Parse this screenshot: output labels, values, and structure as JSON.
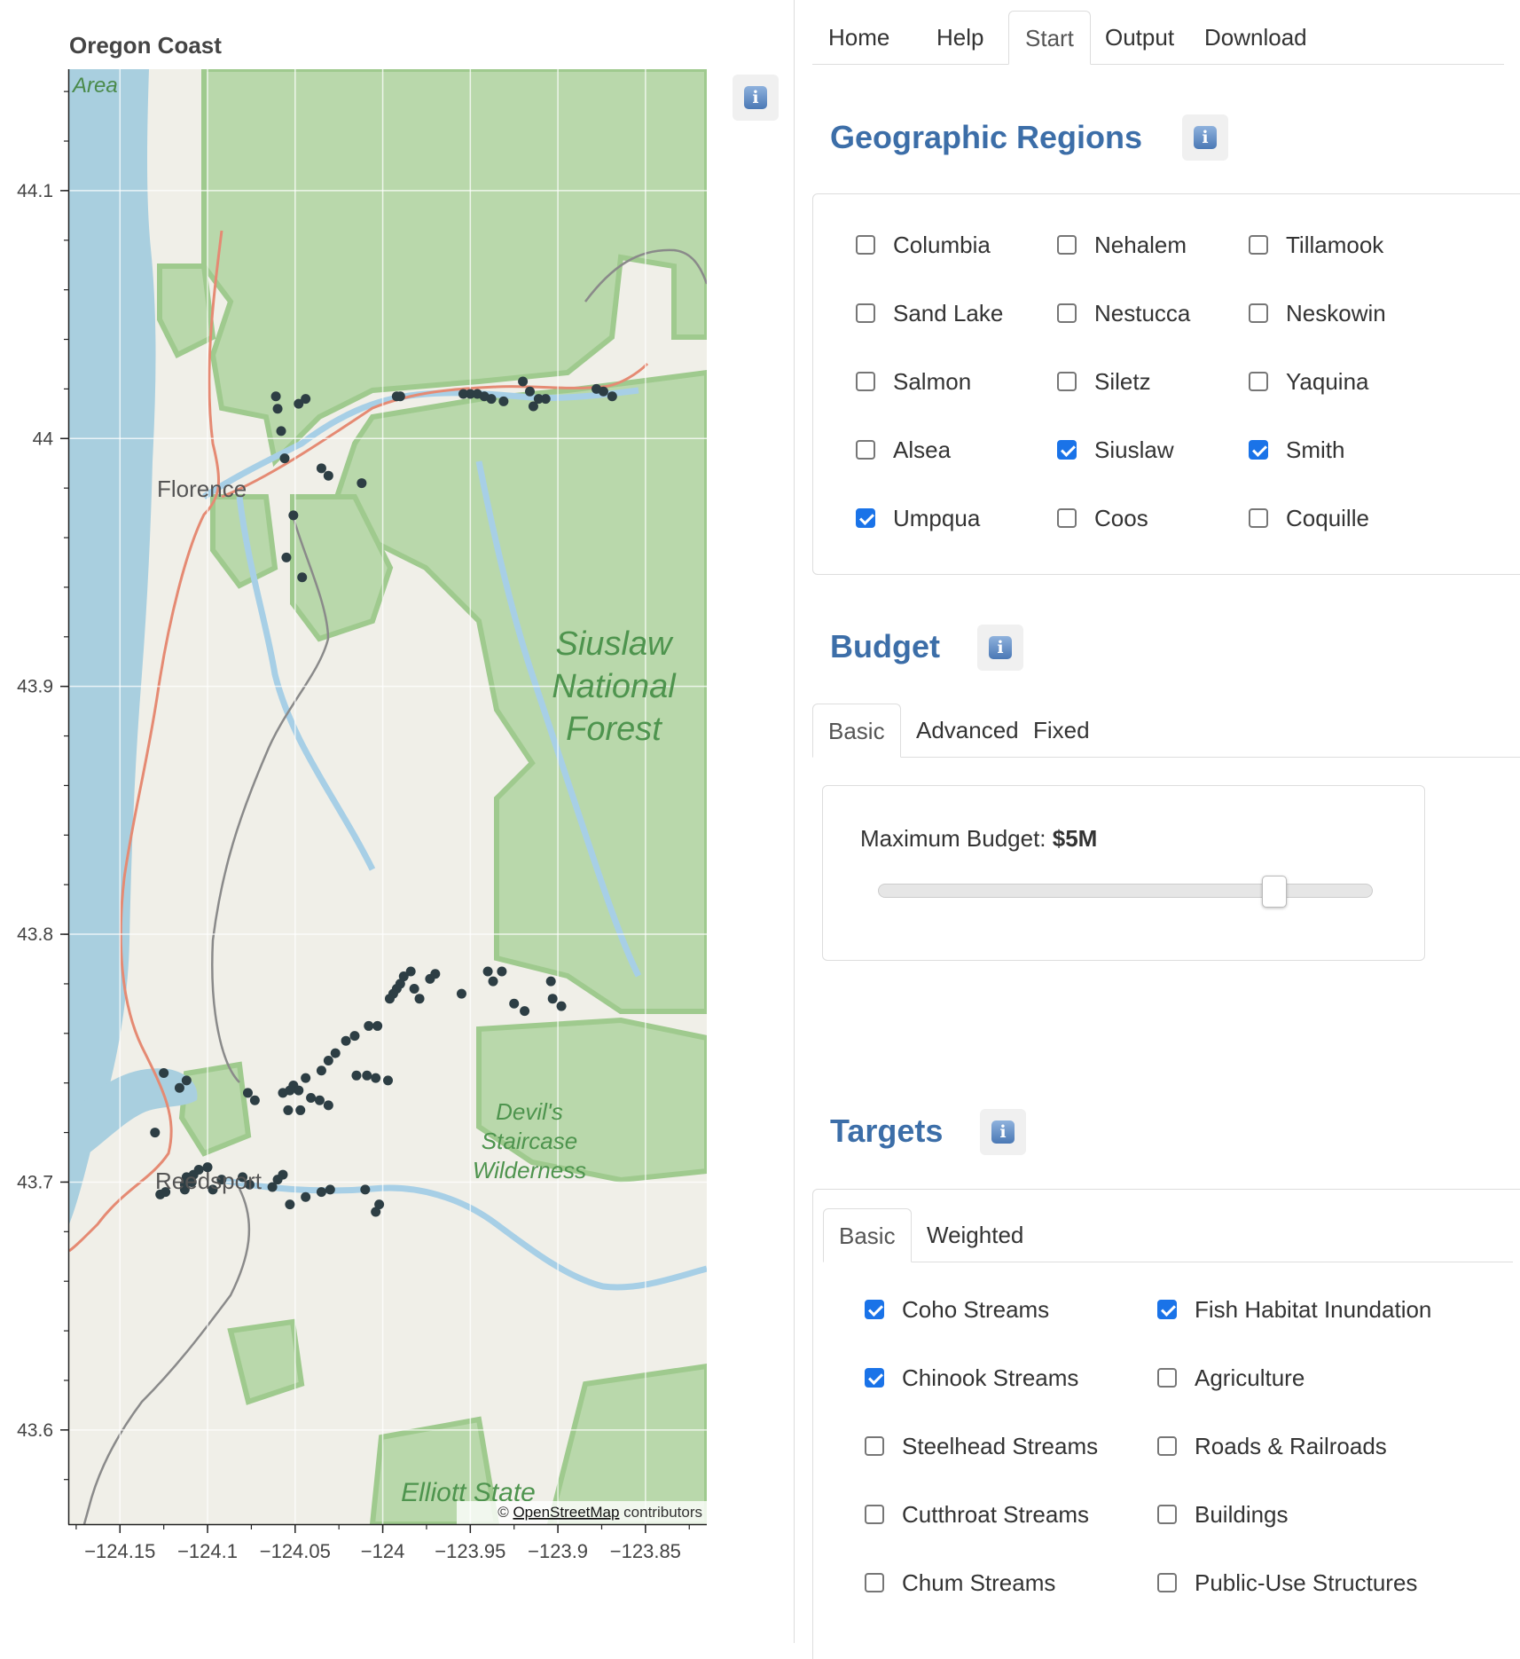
{
  "map": {
    "title": "Oregon Coast",
    "attribution": {
      "prefix": "© ",
      "link": "OpenStreetMap",
      "suffix": " contributors"
    },
    "labels": {
      "florence": "Florence",
      "reedsport": "Reedsport",
      "area": "Area",
      "forest1": "Siuslaw",
      "forest2": "National",
      "forest3": "Forest",
      "wild1": "Devil's",
      "wild2": "Staircase",
      "wild3": "Wilderness",
      "elliott": "Elliott State"
    },
    "colors": {
      "ocean": "#a9cfdf",
      "land": "#f0efe8",
      "forest": "#b9d8ab",
      "forest_edge": "#9fca8e",
      "river": "#a7cfe6",
      "highway": "#e58a73",
      "road": "#8a8a8a",
      "point": "#2d3e44"
    }
  },
  "chart_data": {
    "type": "scatter",
    "title": "Oregon Coast",
    "xlabel": "",
    "ylabel": "",
    "xlim": [
      -124.179,
      -123.815
    ],
    "ylim": [
      43.562,
      44.149
    ],
    "grid": true,
    "xticks": [
      -124.15,
      -124.1,
      -124.05,
      -124,
      -123.95,
      -123.9,
      -123.85
    ],
    "xtick_labels": [
      "−124.15",
      "−124.1",
      "−124.05",
      "−124",
      "−123.95",
      "−123.9",
      "−123.85"
    ],
    "yticks": [
      43.6,
      43.7,
      43.8,
      43.9,
      44,
      44.1
    ],
    "ytick_labels": [
      "43.6",
      "43.7",
      "43.8",
      "43.9",
      "44",
      "44.1"
    ],
    "points": [
      [
        -124.06,
        44.012
      ],
      [
        -124.061,
        44.017
      ],
      [
        -124.058,
        44.003
      ],
      [
        -124.056,
        43.992
      ],
      [
        -124.048,
        44.014
      ],
      [
        -124.044,
        44.016
      ],
      [
        -124.035,
        43.988
      ],
      [
        -124.031,
        43.985
      ],
      [
        -124.012,
        43.982
      ],
      [
        -124.051,
        43.969
      ],
      [
        -124.055,
        43.952
      ],
      [
        -124.046,
        43.944
      ],
      [
        -123.992,
        44.017
      ],
      [
        -123.99,
        44.017
      ],
      [
        -123.954,
        44.018
      ],
      [
        -123.95,
        44.018
      ],
      [
        -123.946,
        44.018
      ],
      [
        -123.942,
        44.017
      ],
      [
        -123.938,
        44.016
      ],
      [
        -123.931,
        44.015
      ],
      [
        -123.92,
        44.023
      ],
      [
        -123.916,
        44.019
      ],
      [
        -123.914,
        44.013
      ],
      [
        -123.911,
        44.016
      ],
      [
        -123.907,
        44.016
      ],
      [
        -123.878,
        44.02
      ],
      [
        -123.874,
        44.019
      ],
      [
        -123.869,
        44.017
      ],
      [
        -123.984,
        43.785
      ],
      [
        -123.988,
        43.783
      ],
      [
        -123.99,
        43.78
      ],
      [
        -123.992,
        43.778
      ],
      [
        -123.994,
        43.776
      ],
      [
        -123.996,
        43.774
      ],
      [
        -123.982,
        43.778
      ],
      [
        -123.979,
        43.774
      ],
      [
        -123.973,
        43.782
      ],
      [
        -123.97,
        43.784
      ],
      [
        -123.955,
        43.776
      ],
      [
        -123.94,
        43.785
      ],
      [
        -123.937,
        43.781
      ],
      [
        -123.932,
        43.785
      ],
      [
        -123.925,
        43.772
      ],
      [
        -123.919,
        43.769
      ],
      [
        -123.904,
        43.781
      ],
      [
        -123.903,
        43.774
      ],
      [
        -123.898,
        43.771
      ],
      [
        -124.003,
        43.763
      ],
      [
        -124.008,
        43.763
      ],
      [
        -124.016,
        43.759
      ],
      [
        -124.021,
        43.757
      ],
      [
        -124.027,
        43.752
      ],
      [
        -124.031,
        43.749
      ],
      [
        -124.035,
        43.745
      ],
      [
        -124.015,
        43.743
      ],
      [
        -124.009,
        43.743
      ],
      [
        -124.004,
        43.742
      ],
      [
        -123.997,
        43.741
      ],
      [
        -124.051,
        43.739
      ],
      [
        -124.048,
        43.737
      ],
      [
        -124.044,
        43.742
      ],
      [
        -124.041,
        43.734
      ],
      [
        -124.036,
        43.733
      ],
      [
        -124.031,
        43.731
      ],
      [
        -124.053,
        43.737
      ],
      [
        -124.057,
        43.736
      ],
      [
        -124.073,
        43.733
      ],
      [
        -124.077,
        43.736
      ],
      [
        -124.054,
        43.729
      ],
      [
        -124.047,
        43.729
      ],
      [
        -124.125,
        43.744
      ],
      [
        -124.116,
        43.738
      ],
      [
        -124.112,
        43.741
      ],
      [
        -124.13,
        43.72
      ],
      [
        -124.112,
        43.702
      ],
      [
        -124.108,
        43.703
      ],
      [
        -124.105,
        43.705
      ],
      [
        -124.1,
        43.706
      ],
      [
        -124.113,
        43.699
      ],
      [
        -124.109,
        43.7
      ],
      [
        -124.092,
        43.701
      ],
      [
        -124.08,
        43.702
      ],
      [
        -124.076,
        43.699
      ],
      [
        -124.127,
        43.695
      ],
      [
        -124.124,
        43.696
      ],
      [
        -124.113,
        43.697
      ],
      [
        -124.097,
        43.697
      ],
      [
        -124.06,
        43.701
      ],
      [
        -124.057,
        43.703
      ],
      [
        -124.063,
        43.698
      ],
      [
        -124.053,
        43.691
      ],
      [
        -124.044,
        43.694
      ],
      [
        -124.035,
        43.696
      ],
      [
        -124.03,
        43.697
      ],
      [
        -124.01,
        43.697
      ],
      [
        -124.002,
        43.691
      ],
      [
        -124.004,
        43.688
      ]
    ]
  },
  "map_ui": {
    "info_icon": "info-icon"
  },
  "nav": {
    "items": [
      "Home",
      "Help",
      "Start",
      "Output",
      "Download"
    ],
    "active": "Start"
  },
  "regions": {
    "title": "Geographic Regions",
    "items": [
      {
        "label": "Columbia",
        "checked": false
      },
      {
        "label": "Nehalem",
        "checked": false
      },
      {
        "label": "Tillamook",
        "checked": false
      },
      {
        "label": "Sand Lake",
        "checked": false
      },
      {
        "label": "Nestucca",
        "checked": false
      },
      {
        "label": "Neskowin",
        "checked": false
      },
      {
        "label": "Salmon",
        "checked": false
      },
      {
        "label": "Siletz",
        "checked": false
      },
      {
        "label": "Yaquina",
        "checked": false
      },
      {
        "label": "Alsea",
        "checked": false
      },
      {
        "label": "Siuslaw",
        "checked": true
      },
      {
        "label": "Smith",
        "checked": true
      },
      {
        "label": "Umpqua",
        "checked": true
      },
      {
        "label": "Coos",
        "checked": false
      },
      {
        "label": "Coquille",
        "checked": false
      }
    ]
  },
  "budget": {
    "title": "Budget",
    "tabs": [
      "Basic",
      "Advanced",
      "Fixed"
    ],
    "active_tab": "Basic",
    "label": "Maximum Budget: ",
    "value": "$5M",
    "slider_fraction": 0.8
  },
  "targets": {
    "title": "Targets",
    "tabs": [
      "Basic",
      "Weighted"
    ],
    "active_tab": "Basic",
    "items": [
      {
        "label": "Coho Streams",
        "checked": true
      },
      {
        "label": "Fish Habitat Inundation",
        "checked": true
      },
      {
        "label": "Chinook Streams",
        "checked": true
      },
      {
        "label": "Agriculture",
        "checked": false
      },
      {
        "label": "Steelhead Streams",
        "checked": false
      },
      {
        "label": "Roads & Railroads",
        "checked": false
      },
      {
        "label": "Cutthroat Streams",
        "checked": false
      },
      {
        "label": "Buildings",
        "checked": false
      },
      {
        "label": "Chum Streams",
        "checked": false
      },
      {
        "label": "Public-Use Structures",
        "checked": false
      }
    ]
  }
}
